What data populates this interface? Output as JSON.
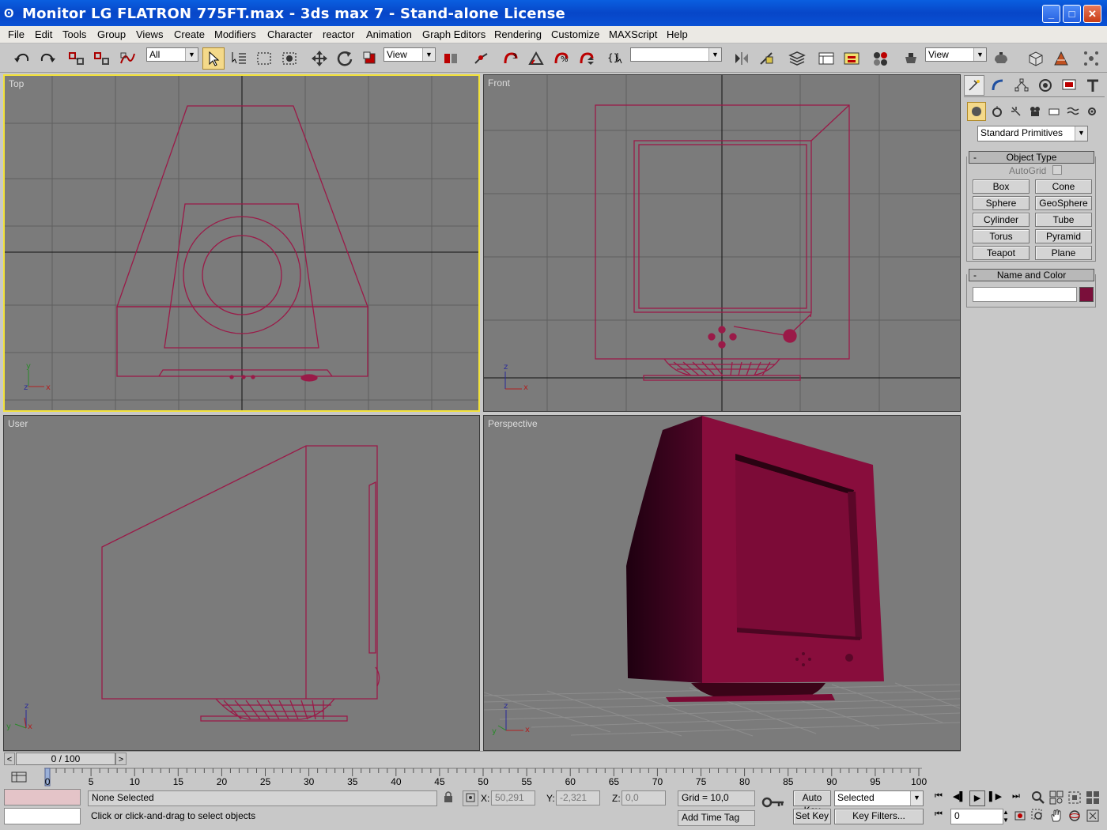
{
  "window": {
    "title": "Monitor LG FLATRON 775FT.max - 3ds max 7  - Stand-alone License",
    "app_icon": "3ds-max-icon",
    "minimize": "_",
    "maximize": "□",
    "close": "✕"
  },
  "menu": [
    "File",
    "Edit",
    "Tools",
    "Group",
    "Views",
    "Create",
    "Modifiers",
    "Character",
    "reactor",
    "Animation",
    "Graph Editors",
    "Rendering",
    "Customize",
    "MAXScript",
    "Help"
  ],
  "toolbar": {
    "selection_filter": "All",
    "ref_coord": "View",
    "named_selection": "",
    "render_view": "View"
  },
  "viewports": {
    "top": "Top",
    "front": "Front",
    "user": "User",
    "perspective": "Perspective"
  },
  "axes": {
    "x": "x",
    "y": "y",
    "z": "z"
  },
  "command_panel": {
    "dropdown": "Standard Primitives",
    "object_type": {
      "title": "Object Type",
      "autogrid": "AutoGrid",
      "buttons": [
        "Box",
        "Cone",
        "Sphere",
        "GeoSphere",
        "Cylinder",
        "Tube",
        "Torus",
        "Pyramid",
        "Teapot",
        "Plane"
      ]
    },
    "name_color": {
      "title": "Name and Color",
      "name_value": "",
      "color": "#7a0f3a"
    }
  },
  "timeline": {
    "slider": "0 / 100",
    "ticks": [
      "0",
      "5",
      "10",
      "15",
      "20",
      "25",
      "30",
      "35",
      "40",
      "45",
      "50",
      "55",
      "60",
      "65",
      "70",
      "75",
      "80",
      "85",
      "90",
      "95",
      "100"
    ]
  },
  "status": {
    "selection": "None Selected",
    "prompt": "Click or click-and-drag to select objects",
    "x_label": "X:",
    "x_value": "50,291",
    "y_label": "Y:",
    "y_value": "-2,321",
    "z_label": "Z:",
    "z_value": "0,0",
    "grid": "Grid = 10,0",
    "add_time_tag": "Add Time Tag",
    "auto_key": "Auto Key",
    "set_key": "Set Key",
    "key_mode": "Selected",
    "key_filters": "Key Filters...",
    "frame": "0"
  },
  "colors": {
    "object": "#8a0e3e",
    "wire": "#9a1a48",
    "active_border": "#f2e23a",
    "titlebar": "#0a54d8"
  }
}
